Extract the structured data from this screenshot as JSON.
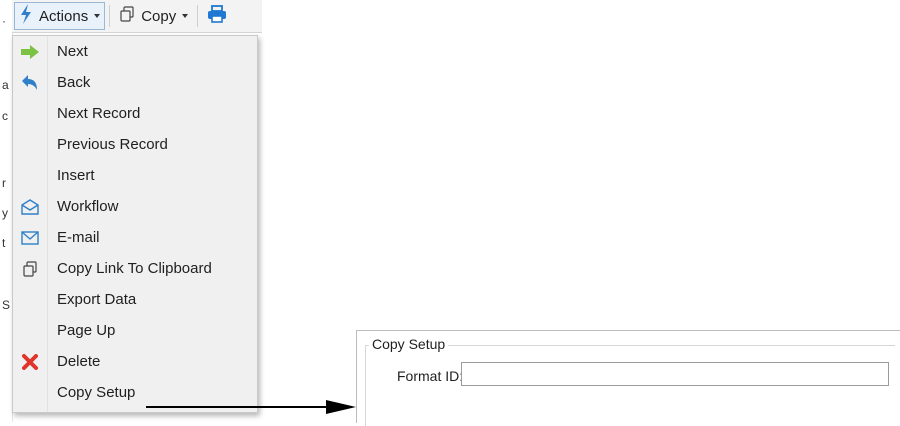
{
  "background": {
    "edge_chars": [
      "·",
      "a",
      "c",
      "r",
      "y",
      "t",
      "S"
    ]
  },
  "toolbar": {
    "actions_label": "Actions",
    "copy_label": "Copy"
  },
  "menu": {
    "items": [
      {
        "label": "Next",
        "icon": "arrow-right-icon"
      },
      {
        "label": "Back",
        "icon": "arrow-back-icon"
      },
      {
        "label": "Next Record",
        "icon": ""
      },
      {
        "label": "Previous Record",
        "icon": ""
      },
      {
        "label": "Insert",
        "icon": ""
      },
      {
        "label": "Workflow",
        "icon": "envelope-open-icon"
      },
      {
        "label": "E-mail",
        "icon": "envelope-icon"
      },
      {
        "label": "Copy Link To Clipboard",
        "icon": "copy-icon"
      },
      {
        "label": "Export Data",
        "icon": ""
      },
      {
        "label": "Page Up",
        "icon": ""
      },
      {
        "label": "Delete",
        "icon": "delete-x-icon"
      },
      {
        "label": "Copy Setup",
        "icon": ""
      }
    ]
  },
  "copy_setup": {
    "group_title": "Copy Setup",
    "format_id_label": "Format ID:",
    "format_id_value": ""
  },
  "colors": {
    "next_green": "#7bc142",
    "back_blue": "#2f80c9",
    "delete_red": "#e0352b",
    "lightning": "#2f80c9",
    "printer": "#1f78d1"
  }
}
